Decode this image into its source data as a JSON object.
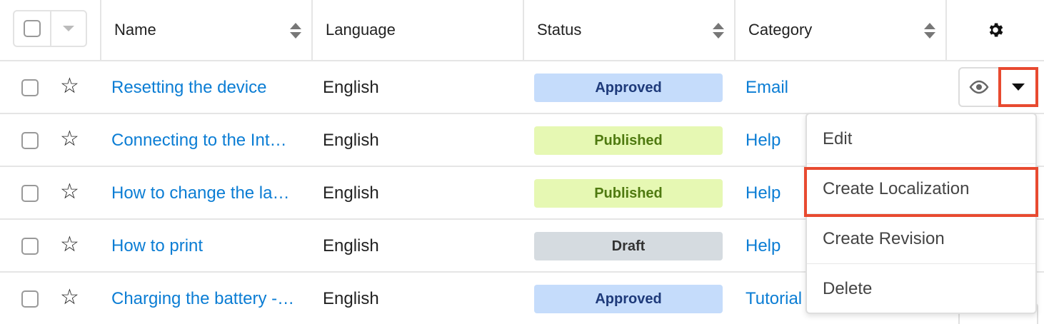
{
  "header": {
    "columns": [
      {
        "label": "Name"
      },
      {
        "label": "Language"
      },
      {
        "label": "Status"
      },
      {
        "label": "Category"
      }
    ]
  },
  "rows": [
    {
      "name": "Resetting the device",
      "language": "English",
      "status": "Approved",
      "category": "Email"
    },
    {
      "name": "Connecting to the Int…",
      "language": "English",
      "status": "Published",
      "category": "Help"
    },
    {
      "name": "How to change the la…",
      "language": "English",
      "status": "Published",
      "category": "Help"
    },
    {
      "name": "How to print",
      "language": "English",
      "status": "Draft",
      "category": "Help"
    },
    {
      "name": "Charging the battery -…",
      "language": "English",
      "status": "Approved",
      "category": "Tutorial"
    }
  ],
  "status_colors": {
    "Approved": {
      "bg": "#c5dcfb",
      "fg": "#1e3a7a"
    },
    "Published": {
      "bg": "#e6f8b3",
      "fg": "#4f7a10"
    },
    "Draft": {
      "bg": "#d5dbe0",
      "fg": "#333333"
    }
  },
  "actions_menu": {
    "items": [
      {
        "label": "Edit"
      },
      {
        "label": "Create Localization"
      },
      {
        "label": "Create Revision"
      },
      {
        "label": "Delete"
      }
    ]
  },
  "icons": {
    "settings": "gear-icon",
    "preview": "eye-icon",
    "favorite": "star-icon",
    "dropdown": "caret-down-icon"
  },
  "accent": {
    "link": "#0b7dd4",
    "highlight": "#e84a30"
  }
}
